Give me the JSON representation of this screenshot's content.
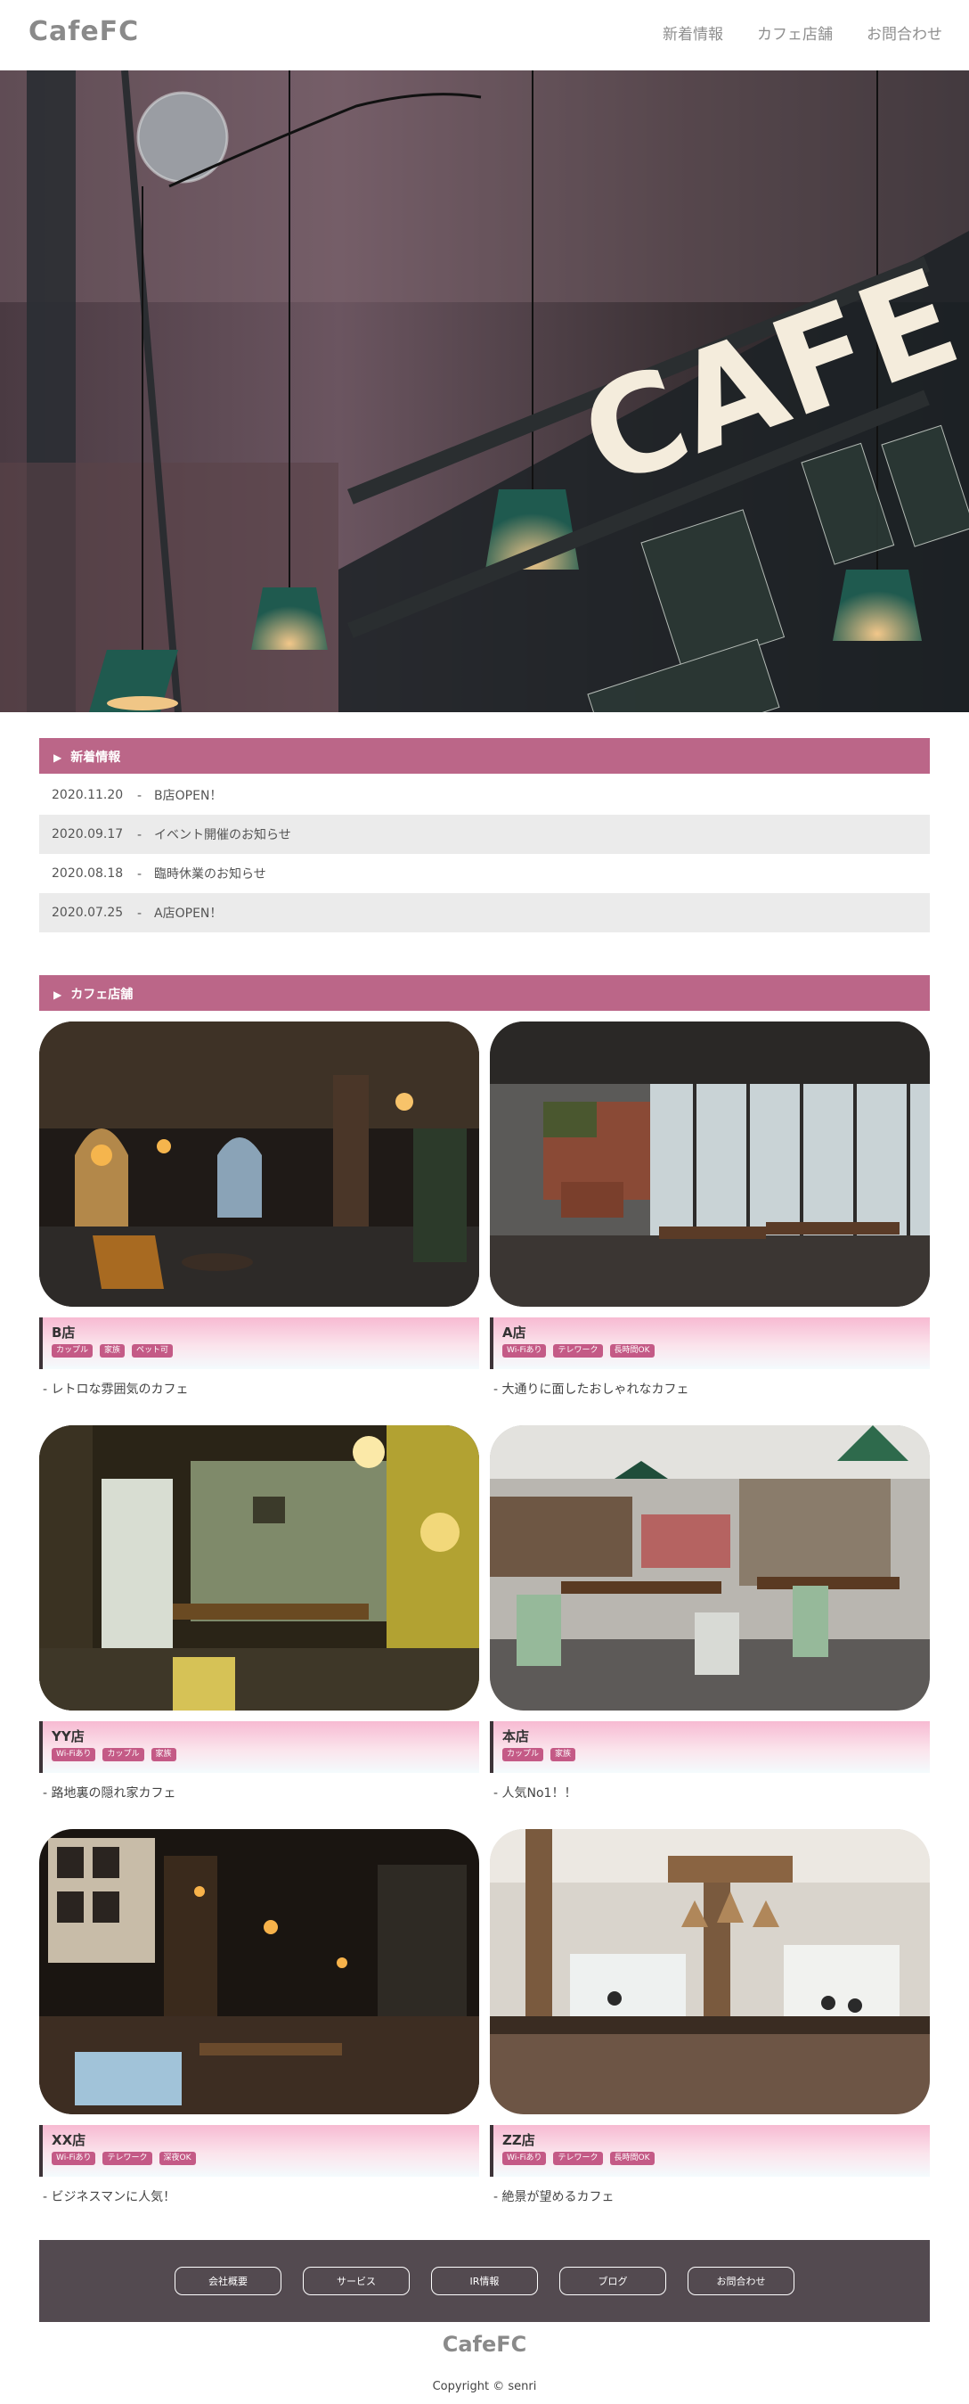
{
  "header": {
    "logo": "CafeFC",
    "nav": [
      "新着情報",
      "カフェ店舗",
      "お問合わせ"
    ]
  },
  "hero": {
    "sign_text": "CAFE"
  },
  "news": {
    "heading": "新着情報",
    "items": [
      {
        "date": "2020.11.20",
        "title": "-　B店OPEN！"
      },
      {
        "date": "2020.09.17",
        "title": "-　イベント開催のお知らせ"
      },
      {
        "date": "2020.08.18",
        "title": "-　臨時休業のお知らせ"
      },
      {
        "date": "2020.07.25",
        "title": "-　A店OPEN！"
      }
    ]
  },
  "shops": {
    "heading": "カフェ店舗",
    "items": [
      {
        "name": "B店",
        "tags": [
          "カップル",
          "家族",
          "ペット可"
        ],
        "desc": "- レトロな雰囲気のカフェ"
      },
      {
        "name": "A店",
        "tags": [
          "Wi-Fiあり",
          "テレワーク",
          "長時間OK"
        ],
        "desc": "- 大通りに面したおしゃれなカフェ"
      },
      {
        "name": "YY店",
        "tags": [
          "Wi-Fiあり",
          "カップル",
          "家族"
        ],
        "desc": "- 路地裏の隠れ家カフェ"
      },
      {
        "name": "本店",
        "tags": [
          "カップル",
          "家族"
        ],
        "desc": "- 人気No1！！"
      },
      {
        "name": "XX店",
        "tags": [
          "Wi-Fiあり",
          "テレワーク",
          "深夜OK"
        ],
        "desc": "- ビジネスマンに人気！"
      },
      {
        "name": "ZZ店",
        "tags": [
          "Wi-Fiあり",
          "テレワーク",
          "長時間OK"
        ],
        "desc": "- 絶景が望めるカフェ"
      }
    ]
  },
  "footer": {
    "links": [
      "会社概要",
      "サービス",
      "IR情報",
      "ブログ",
      "お問合わせ"
    ],
    "logo": "CafeFC",
    "copyright": "Copyright © senri"
  },
  "colors": {
    "accent": "#bb6688",
    "tag": "#c45a86",
    "footer_bg": "#534a50",
    "alt_row": "#ebebeb"
  }
}
